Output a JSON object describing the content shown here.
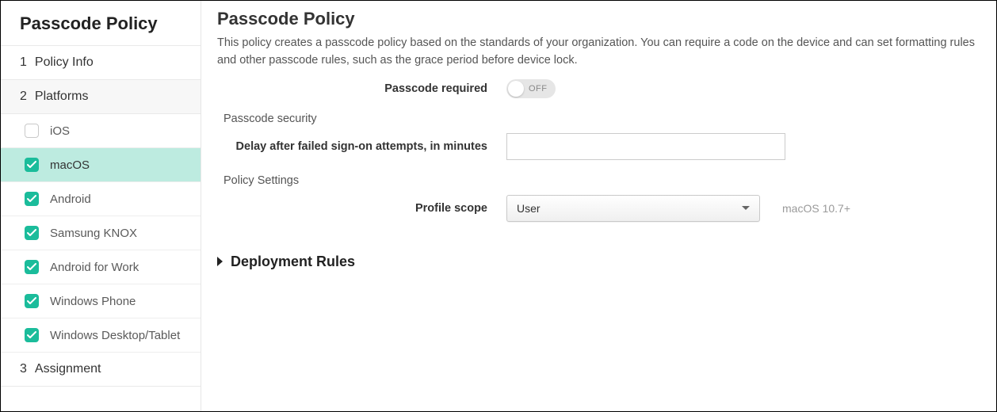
{
  "sidebar": {
    "title": "Passcode Policy",
    "steps": [
      {
        "num": "1",
        "label": "Policy Info"
      },
      {
        "num": "2",
        "label": "Platforms"
      },
      {
        "num": "3",
        "label": "Assignment"
      }
    ],
    "platforms": [
      {
        "label": "iOS",
        "checked": false,
        "selected": false
      },
      {
        "label": "macOS",
        "checked": true,
        "selected": true
      },
      {
        "label": "Android",
        "checked": true,
        "selected": false
      },
      {
        "label": "Samsung KNOX",
        "checked": true,
        "selected": false
      },
      {
        "label": "Android for Work",
        "checked": true,
        "selected": false
      },
      {
        "label": "Windows Phone",
        "checked": true,
        "selected": false
      },
      {
        "label": "Windows Desktop/Tablet",
        "checked": true,
        "selected": false
      }
    ]
  },
  "main": {
    "title": "Passcode Policy",
    "description": "This policy creates a passcode policy based on the standards of your organization. You can require a code on the device and can set formatting rules and other passcode rules, such as the grace period before device lock.",
    "passcode_required_label": "Passcode required",
    "toggle_off": "OFF",
    "section_security": "Passcode security",
    "delay_label": "Delay after failed sign-on attempts, in minutes",
    "delay_value": "",
    "section_policy": "Policy Settings",
    "profile_scope_label": "Profile scope",
    "profile_scope_value": "User",
    "profile_scope_hint": "macOS 10.7+",
    "deployment_rules": "Deployment Rules"
  }
}
